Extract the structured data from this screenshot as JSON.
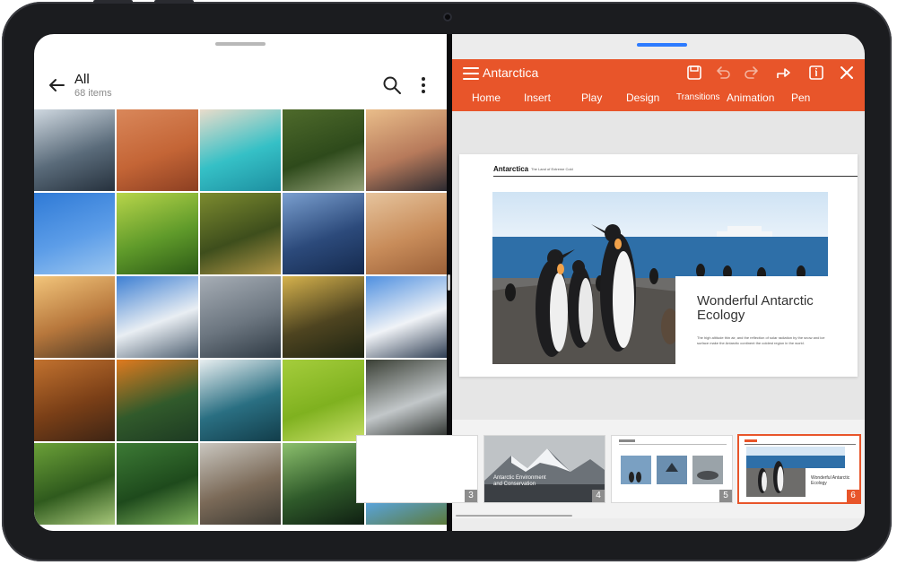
{
  "gallery": {
    "title": "All",
    "subtitle": "68 items",
    "icons": {
      "back": "arrow-left-icon",
      "search": "search-icon",
      "more": "more-vertical-icon"
    },
    "photos": [
      {
        "name": "photo-snowy-mountain-lake",
        "colors": [
          "#cfd8e0",
          "#5a6b7a",
          "#26313d"
        ]
      },
      {
        "name": "photo-desert-dunes",
        "colors": [
          "#d9875a",
          "#c46536",
          "#8c3f22"
        ]
      },
      {
        "name": "photo-turquoise-pools",
        "colors": [
          "#e9dccb",
          "#35c0c6",
          "#1d8fa0"
        ]
      },
      {
        "name": "photo-forest-river",
        "colors": [
          "#4e6a2b",
          "#2e4a1b",
          "#96a37a"
        ]
      },
      {
        "name": "photo-volcano-sunset",
        "colors": [
          "#e9bd8a",
          "#b77a5b",
          "#2c2a30"
        ]
      },
      {
        "name": "photo-bare-tree",
        "colors": [
          "#2f7ad6",
          "#5c9de8",
          "#9bc6f0"
        ]
      },
      {
        "name": "photo-beetle-leaf",
        "colors": [
          "#b8d54a",
          "#5f9a2a",
          "#2d5a16"
        ]
      },
      {
        "name": "photo-forest-path",
        "colors": [
          "#7c8b2f",
          "#3e4e1c",
          "#b09547"
        ]
      },
      {
        "name": "photo-blue-cliffs",
        "colors": [
          "#7a9fcf",
          "#2c4a7b",
          "#152a4e"
        ]
      },
      {
        "name": "photo-sand-dunes",
        "colors": [
          "#e6c49d",
          "#c88c5a",
          "#9b6038"
        ]
      },
      {
        "name": "photo-golden-valley",
        "colors": [
          "#f2c57b",
          "#b7773c",
          "#4f3b26"
        ]
      },
      {
        "name": "photo-snow-peaks",
        "colors": [
          "#3d7fd3",
          "#e9eef3",
          "#4e5f70"
        ]
      },
      {
        "name": "photo-grey-mountains",
        "colors": [
          "#a6adb5",
          "#6c7680",
          "#2f3a44"
        ]
      },
      {
        "name": "photo-dark-forest-sun",
        "colors": [
          "#d6b24d",
          "#4e4420",
          "#1e2412"
        ]
      },
      {
        "name": "photo-alpine-ridge",
        "colors": [
          "#4e8fe0",
          "#f0f3f7",
          "#2e3d52"
        ]
      },
      {
        "name": "photo-autumn-pines",
        "colors": [
          "#c2722f",
          "#7a3f17",
          "#3d2414"
        ]
      },
      {
        "name": "photo-autumn-aerial",
        "colors": [
          "#e07a1f",
          "#315a2b",
          "#1d3a22"
        ]
      },
      {
        "name": "photo-ocean-waves",
        "colors": [
          "#e8eef0",
          "#2a6f82",
          "#123d4a"
        ]
      },
      {
        "name": "photo-green-leaf",
        "colors": [
          "#a5cd3c",
          "#7fb11f",
          "#c9e06a"
        ]
      },
      {
        "name": "photo-waterfall-cliff",
        "colors": [
          "#3a3f35",
          "#c2c7c9",
          "#202420"
        ]
      },
      {
        "name": "photo-green-canopy",
        "colors": [
          "#6ba038",
          "#2f5a1d",
          "#a7c77a"
        ]
      },
      {
        "name": "photo-fern-leaves",
        "colors": [
          "#3c7a35",
          "#1e4a1c",
          "#7fb15c"
        ]
      },
      {
        "name": "photo-misty-falls",
        "colors": [
          "#c9c6bf",
          "#7b6a58",
          "#3d3a33"
        ]
      },
      {
        "name": "photo-tulip-buds",
        "colors": [
          "#8cc06d",
          "#2f5a2a",
          "#0f1f12"
        ]
      },
      {
        "name": "photo-autumn-lake",
        "colors": [
          "#d98c2a",
          "#5aa3d8",
          "#5c7a3a"
        ]
      }
    ]
  },
  "slides": {
    "doc_title": "Antarctica",
    "toolbar_icons": [
      "save-icon",
      "undo-icon",
      "redo-icon",
      "share-icon",
      "info-icon",
      "close-icon"
    ],
    "tabs": [
      "Home",
      "Insert",
      "Play",
      "Design",
      "Transitions",
      "Animation",
      "Pen"
    ],
    "current_slide": {
      "heading": "Antarctica",
      "heading_sub": "The Land of Extreme Cold",
      "title": "Wonderful Antarctic Ecology",
      "body": "The high altitude thin air, and the reflection of solar radiation by the snow and ice surface make the Antarctic continent the coldest region in the world."
    },
    "thumbnails": [
      {
        "number": "3",
        "caption": ""
      },
      {
        "number": "4",
        "caption": "Antarctic Environment and Conservation"
      },
      {
        "number": "5",
        "caption": ""
      },
      {
        "number": "6",
        "caption": "Wonderful Antarctic Ecology"
      }
    ],
    "accent": "#e8552a"
  }
}
